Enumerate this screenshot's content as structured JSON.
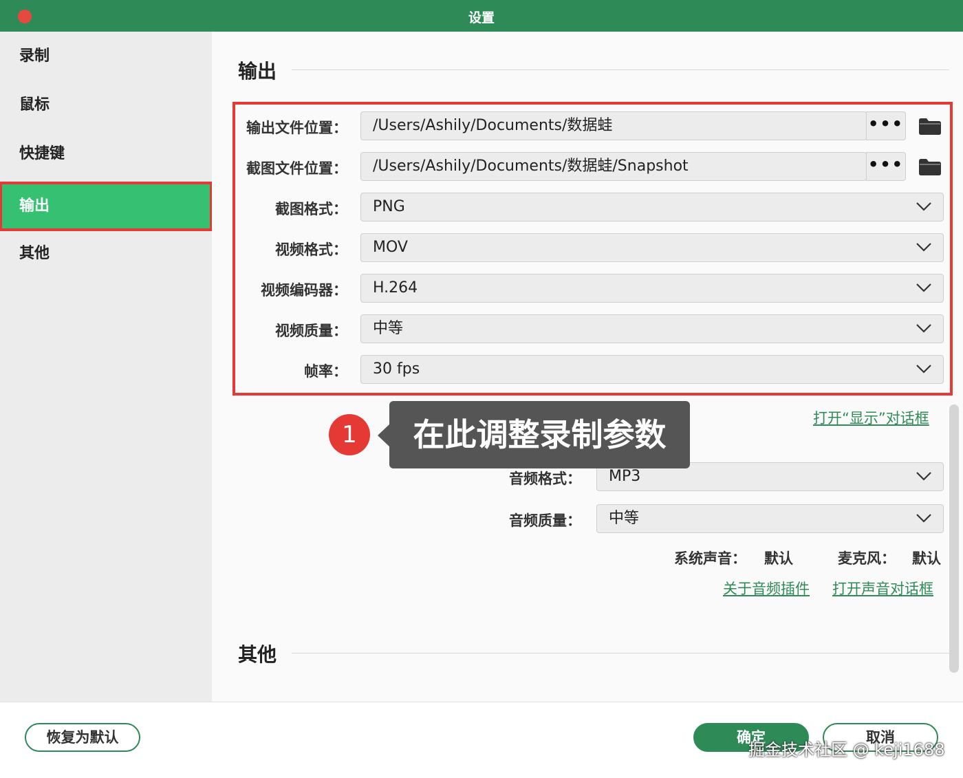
{
  "window": {
    "title": "设置"
  },
  "sidebar": {
    "items": [
      {
        "label": "录制"
      },
      {
        "label": "鼠标"
      },
      {
        "label": "快捷键"
      },
      {
        "label": "输出",
        "active": true
      },
      {
        "label": "其他"
      }
    ]
  },
  "output": {
    "section_title": "输出",
    "output_path": {
      "label": "输出文件位置：",
      "value": "/Users/Ashily/Documents/数据蛙",
      "browse": "•••"
    },
    "snapshot_path": {
      "label": "截图文件位置：",
      "value": "/Users/Ashily/Documents/数据蛙/Snapshot",
      "browse": "•••"
    },
    "snapshot_format": {
      "label": "截图格式：",
      "value": "PNG"
    },
    "video_format": {
      "label": "视频格式：",
      "value": "MOV"
    },
    "video_codec": {
      "label": "视频编码器：",
      "value": "H.264"
    },
    "video_quality": {
      "label": "视频质量：",
      "value": "中等"
    },
    "frame_rate": {
      "label": "帧率：",
      "value": "30 fps"
    },
    "open_display_link": "打开“显示”对话框",
    "audio_format": {
      "label": "音频格式：",
      "value": "MP3"
    },
    "audio_quality": {
      "label": "音频质量：",
      "value": "中等"
    },
    "system_sound": {
      "label": "系统声音：",
      "value": "默认"
    },
    "microphone": {
      "label": "麦克风：",
      "value": "默认"
    },
    "audio_plugin_link": "关于音频插件",
    "open_sound_link": "打开声音对话框"
  },
  "other": {
    "section_title": "其他"
  },
  "callout": {
    "number": "1",
    "text": "在此调整录制参数"
  },
  "footer": {
    "restore_label": "恢复为默认",
    "ok_label": "确定",
    "cancel_label": "取消"
  },
  "watermark": "掘金技术社区 @ keji1688",
  "colors": {
    "titlebar": "#2e8b57",
    "active_item": "#36c172",
    "highlight": "#e53935"
  }
}
